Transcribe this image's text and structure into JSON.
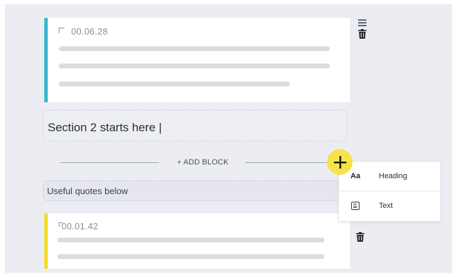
{
  "blocks": [
    {
      "type": "note",
      "timestamp": "00.06.28",
      "accent": "#39b7cc"
    },
    {
      "type": "note",
      "timestamp": "00.01.42",
      "accent": "#f4db2a"
    }
  ],
  "section_heading": "Section 2 starts here |",
  "add_block": {
    "label": "+ ADD BLOCK"
  },
  "quote_text": "Useful quotes below",
  "dropdown": {
    "items": [
      {
        "icon_glyph": "Aa",
        "label": "Heading"
      },
      {
        "icon": "text-icon",
        "label": "Text"
      }
    ]
  },
  "colors": {
    "accent_button": "#f7e24a",
    "background": "#ecedf3"
  }
}
